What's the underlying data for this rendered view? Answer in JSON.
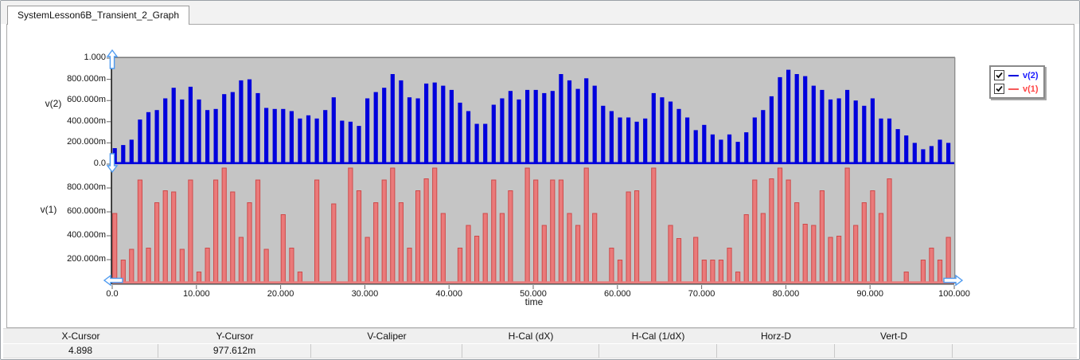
{
  "tab": {
    "title": "SystemLesson6B_Transient_2_Graph"
  },
  "axes": {
    "y2_name": "v(2)",
    "y1_name": "v(1)",
    "x_name": "time"
  },
  "legend": {
    "items": [
      {
        "label": "v(2)",
        "color": "#0000dd",
        "label_color": "#1a1aff",
        "checked": true
      },
      {
        "label": "v(1)",
        "color": "#f55a5a",
        "label_color": "#ff4444",
        "checked": true
      }
    ]
  },
  "cursor_table": {
    "headers": [
      "X-Cursor",
      "Y-Cursor",
      "V-Caliper",
      "H-Cal (dX)",
      "H-Cal (1/dX)",
      "Horz-D",
      "Vert-D"
    ],
    "values": [
      "4.898",
      "977.612m",
      "",
      "",
      "",
      "",
      ""
    ]
  },
  "chart_data": {
    "type": "bar",
    "title": "",
    "xlabel": "time",
    "x_range": [
      0,
      100
    ],
    "grid": false,
    "legend_position": "top-right",
    "x_ticks": [
      "0.0",
      "10.000",
      "20.000",
      "30.000",
      "40.000",
      "50.000",
      "60.000",
      "70.000",
      "80.000",
      "90.000",
      "100.000"
    ],
    "panels": [
      {
        "name": "v(2)",
        "color": "#0000dd",
        "y_range": [
          0,
          1
        ],
        "y_ticks": [
          {
            "v": 1.0,
            "label": "1.000"
          },
          {
            "v": 0.8,
            "label": "800.000m"
          },
          {
            "v": 0.6,
            "label": "600.000m"
          },
          {
            "v": 0.4,
            "label": "400.000m"
          },
          {
            "v": 0.2,
            "label": "200.000m"
          },
          {
            "v": 0.0,
            "label": "0.0"
          }
        ],
        "t0": 0.3,
        "dt": 1.0,
        "values": [
          0.15,
          0.18,
          0.23,
          0.42,
          0.49,
          0.51,
          0.62,
          0.72,
          0.61,
          0.73,
          0.61,
          0.51,
          0.52,
          0.66,
          0.68,
          0.79,
          0.8,
          0.67,
          0.53,
          0.52,
          0.52,
          0.5,
          0.43,
          0.46,
          0.43,
          0.51,
          0.63,
          0.41,
          0.4,
          0.36,
          0.62,
          0.68,
          0.72,
          0.85,
          0.79,
          0.63,
          0.62,
          0.76,
          0.77,
          0.74,
          0.7,
          0.58,
          0.5,
          0.38,
          0.38,
          0.56,
          0.62,
          0.69,
          0.61,
          0.7,
          0.7,
          0.67,
          0.69,
          0.85,
          0.79,
          0.71,
          0.81,
          0.74,
          0.55,
          0.5,
          0.44,
          0.44,
          0.4,
          0.43,
          0.67,
          0.63,
          0.59,
          0.52,
          0.44,
          0.32,
          0.37,
          0.28,
          0.23,
          0.28,
          0.21,
          0.3,
          0.44,
          0.51,
          0.64,
          0.82,
          0.89,
          0.85,
          0.83,
          0.74,
          0.7,
          0.61,
          0.62,
          0.7,
          0.6,
          0.55,
          0.62,
          0.43,
          0.43,
          0.33,
          0.27,
          0.2,
          0.14,
          0.17,
          0.23,
          0.2
        ]
      },
      {
        "name": "v(1)",
        "color": "#cf4a4a",
        "fill": "#ea7a7a",
        "y_range": [
          0,
          1
        ],
        "y_ticks": [
          {
            "v": 0.8,
            "label": "800.000m"
          },
          {
            "v": 0.6,
            "label": "600.000m"
          },
          {
            "v": 0.4,
            "label": "400.000m"
          },
          {
            "v": 0.2,
            "label": "200.000m"
          }
        ],
        "pulses": [
          [
            0.3,
            0.58
          ],
          [
            1.3,
            0.19
          ],
          [
            2.3,
            0.28
          ],
          [
            3.3,
            0.86
          ],
          [
            4.3,
            0.29
          ],
          [
            5.3,
            0.67
          ],
          [
            6.3,
            0.77
          ],
          [
            7.3,
            0.76
          ],
          [
            8.3,
            0.28
          ],
          [
            9.3,
            0.86
          ],
          [
            10.3,
            0.09
          ],
          [
            11.3,
            0.29
          ],
          [
            12.3,
            0.86
          ],
          [
            13.3,
            0.96
          ],
          [
            14.3,
            0.76
          ],
          [
            15.3,
            0.38
          ],
          [
            16.3,
            0.67
          ],
          [
            17.3,
            0.86
          ],
          [
            18.3,
            0.28
          ],
          [
            20.3,
            0.57
          ],
          [
            21.3,
            0.29
          ],
          [
            22.3,
            0.09
          ],
          [
            24.3,
            0.86
          ],
          [
            26.3,
            0.66
          ],
          [
            28.3,
            0.96
          ],
          [
            29.3,
            0.77
          ],
          [
            30.3,
            0.38
          ],
          [
            31.3,
            0.67
          ],
          [
            32.3,
            0.86
          ],
          [
            33.3,
            0.96
          ],
          [
            34.3,
            0.67
          ],
          [
            35.3,
            0.29
          ],
          [
            36.3,
            0.77
          ],
          [
            37.3,
            0.87
          ],
          [
            38.3,
            0.96
          ],
          [
            39.3,
            0.58
          ],
          [
            41.3,
            0.29
          ],
          [
            42.3,
            0.48
          ],
          [
            43.3,
            0.39
          ],
          [
            44.3,
            0.58
          ],
          [
            45.3,
            0.86
          ],
          [
            46.3,
            0.58
          ],
          [
            47.3,
            0.77
          ],
          [
            49.3,
            0.96
          ],
          [
            50.3,
            0.86
          ],
          [
            51.3,
            0.48
          ],
          [
            52.3,
            0.86
          ],
          [
            53.3,
            0.86
          ],
          [
            54.3,
            0.58
          ],
          [
            55.3,
            0.48
          ],
          [
            56.3,
            0.96
          ],
          [
            57.3,
            0.58
          ],
          [
            59.3,
            0.29
          ],
          [
            60.3,
            0.19
          ],
          [
            61.3,
            0.76
          ],
          [
            62.3,
            0.77
          ],
          [
            64.3,
            0.96
          ],
          [
            66.3,
            0.48
          ],
          [
            67.3,
            0.37
          ],
          [
            69.3,
            0.38
          ],
          [
            70.3,
            0.19
          ],
          [
            71.3,
            0.19
          ],
          [
            72.3,
            0.19
          ],
          [
            73.3,
            0.29
          ],
          [
            74.3,
            0.09
          ],
          [
            75.3,
            0.57
          ],
          [
            76.3,
            0.86
          ],
          [
            77.3,
            0.58
          ],
          [
            78.3,
            0.87
          ],
          [
            79.3,
            0.96
          ],
          [
            80.3,
            0.86
          ],
          [
            81.3,
            0.67
          ],
          [
            82.3,
            0.49
          ],
          [
            83.3,
            0.48
          ],
          [
            84.3,
            0.77
          ],
          [
            85.3,
            0.38
          ],
          [
            86.3,
            0.39
          ],
          [
            87.3,
            0.96
          ],
          [
            88.3,
            0.48
          ],
          [
            89.3,
            0.67
          ],
          [
            90.3,
            0.77
          ],
          [
            91.3,
            0.58
          ],
          [
            92.3,
            0.87
          ],
          [
            94.3,
            0.09
          ],
          [
            96.3,
            0.19
          ],
          [
            97.3,
            0.29
          ],
          [
            98.3,
            0.19
          ],
          [
            99.3,
            0.38
          ]
        ]
      }
    ]
  }
}
